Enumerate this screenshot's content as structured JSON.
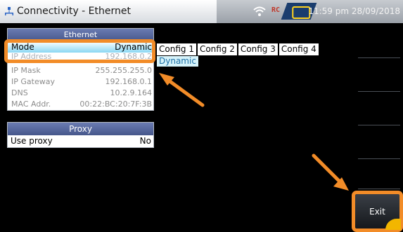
{
  "titlebar": {
    "title": "Connectivity - Ethernet",
    "rtc_badge": "RC",
    "clock": "11:59 pm 28/09/2018"
  },
  "ethernet_panel": {
    "header": "Ethernet",
    "mode": {
      "label": "Mode",
      "value": "Dynamic"
    },
    "rows": [
      {
        "label": "IP Address",
        "value": "192.168.0.2"
      },
      {
        "label": "IP Mask",
        "value": "255.255.255.0"
      },
      {
        "label": "IP Gateway",
        "value": "192.168.0.1"
      },
      {
        "label": "DNS",
        "value": "10.2.9.164"
      },
      {
        "label": "MAC Addr.",
        "value": "00:22:BC:20:7F:3B"
      }
    ]
  },
  "proxy_panel": {
    "header": "Proxy",
    "use_proxy": {
      "label": "Use proxy",
      "value": "No"
    }
  },
  "configs": [
    "Config 1",
    "Config 2",
    "Config 3",
    "Config 4"
  ],
  "mode_option": "Dynamic",
  "softkeys": {
    "exit_label": "Exit"
  },
  "colors": {
    "highlight": "#f28c28",
    "accent": "#8ad7f3",
    "header": "#46578b"
  }
}
